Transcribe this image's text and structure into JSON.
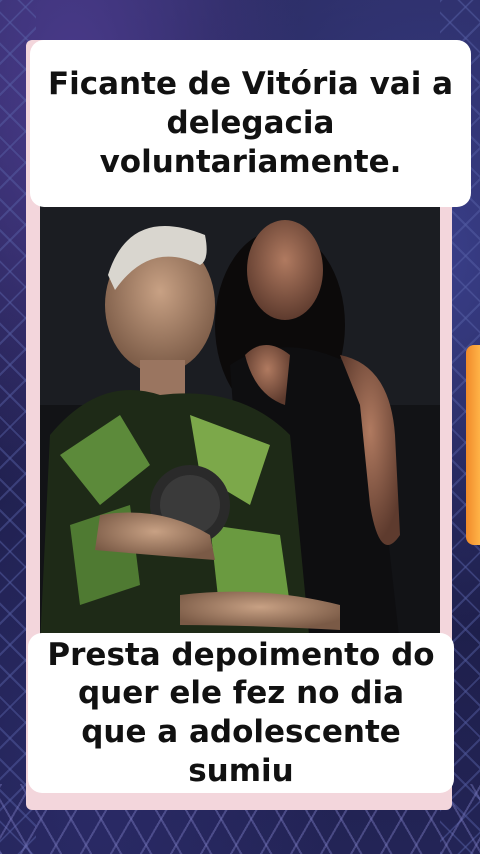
{
  "captions": {
    "top": "Ficante de Vitória vai a delegacia voluntariamente.",
    "bottom": "Presta depoimento do quer ele fez no dia que a adolescente sumiu"
  },
  "colors": {
    "background": "#1f2050",
    "panel": "#f3d6dc",
    "caption_bg": "#ffffff",
    "caption_text": "#111111",
    "accent_side_card": "#f39a36"
  }
}
